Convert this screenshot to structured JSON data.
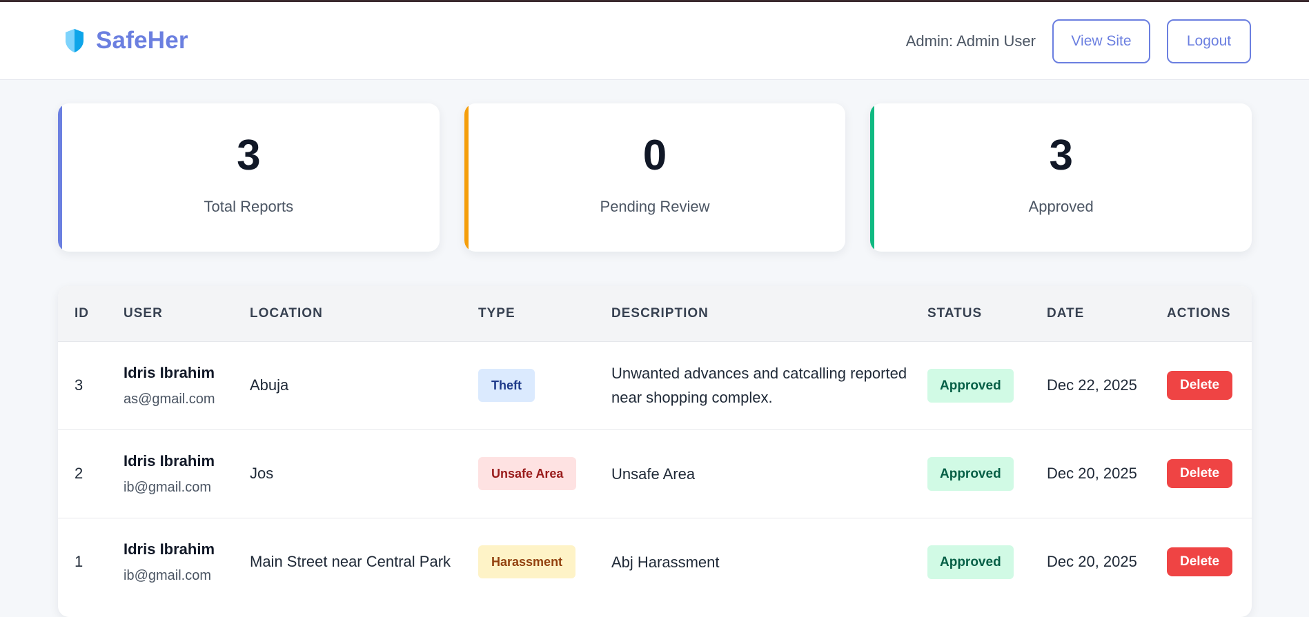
{
  "brand": {
    "name": "SafeHer",
    "icon": "shield-icon",
    "color": "#6b7fe0"
  },
  "nav": {
    "admin_label": "Admin: Admin User",
    "view_site_label": "View Site",
    "logout_label": "Logout"
  },
  "stats": [
    {
      "value": "3",
      "label": "Total Reports",
      "accent": "#6b7fe0"
    },
    {
      "value": "0",
      "label": "Pending Review",
      "accent": "#f59e0b"
    },
    {
      "value": "3",
      "label": "Approved",
      "accent": "#10b981"
    }
  ],
  "table": {
    "headers": [
      "ID",
      "USER",
      "LOCATION",
      "TYPE",
      "DESCRIPTION",
      "STATUS",
      "DATE",
      "ACTIONS"
    ],
    "rows": [
      {
        "id": "3",
        "user_name": "Idris Ibrahim",
        "user_email": "as@gmail.com",
        "location": "Abuja",
        "type": "Theft",
        "type_bg": "#dbeafe",
        "type_color": "#1e3a8a",
        "description": "Unwanted advances and catcalling reported near shopping complex.",
        "status": "Approved",
        "date": "Dec 22, 2025",
        "action": "Delete"
      },
      {
        "id": "2",
        "user_name": "Idris Ibrahim",
        "user_email": "ib@gmail.com",
        "location": "Jos",
        "type": "Unsafe Area",
        "type_bg": "#fee2e2",
        "type_color": "#991b1b",
        "description": "Unsafe Area",
        "status": "Approved",
        "date": "Dec 20, 2025",
        "action": "Delete"
      },
      {
        "id": "1",
        "user_name": "Idris Ibrahim",
        "user_email": "ib@gmail.com",
        "location": "Main Street near Central Park",
        "type": "Harassment",
        "type_bg": "#fef3c7",
        "type_color": "#92400e",
        "description": "Abj Harassment",
        "status": "Approved",
        "date": "Dec 20, 2025",
        "action": "Delete"
      }
    ]
  }
}
